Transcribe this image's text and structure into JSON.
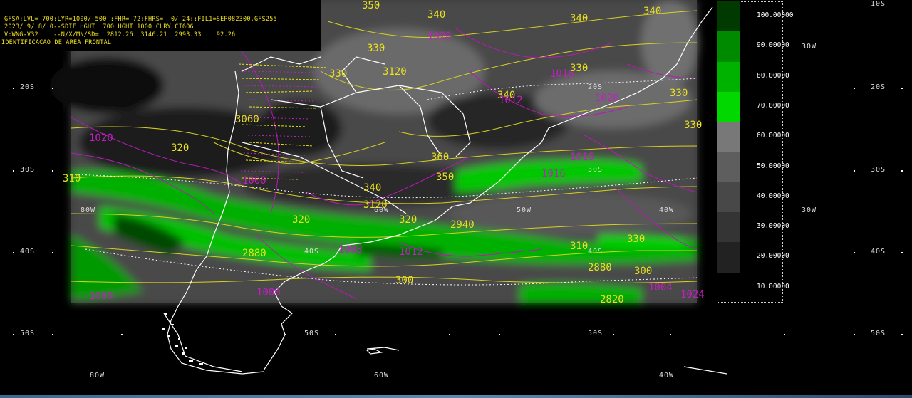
{
  "header": {
    "line1": "GFSA:LVL= 700:LYR=1000/ 500 :FHR= 72:FHRS=  0/ 24::FIL1=SEP082300.GFS255",
    "line2": "2023/ 9/ 8/ 0--SDIF HGHT  700 HGHT 1000 CLRY CI606",
    "line3": "V:WNG-V32    --N/X/MN/SD=  2812.26  3146.21  2993.33    92.26",
    "line4": "IDENTIFICACAO DE AREA FRONTAL"
  },
  "legend": {
    "levels": [
      "100.00000",
      "90.00000",
      "80.00000",
      "70.00000",
      "60.00000",
      "50.00000",
      "40.00000",
      "30.00000",
      "20.00000",
      "10.00000"
    ],
    "colors": [
      "#003a00",
      "#008a00",
      "#00b200",
      "#00d800",
      "#787878",
      "#5e5e5e",
      "#484848",
      "#343434",
      "#222222",
      "#111111"
    ]
  },
  "grid_labels": {
    "lat": [
      "20S",
      "30S",
      "40S",
      "50S"
    ],
    "lon": [
      "80W",
      "60W",
      "40W",
      "30W"
    ]
  },
  "contour_labels_yellow": [
    "350",
    "330",
    "320",
    "310",
    "340",
    "3120",
    "330",
    "3060",
    "360",
    "350",
    "340",
    "330",
    "320",
    "320",
    "340",
    "330",
    "3120",
    "310",
    "300",
    "330",
    "330",
    "340",
    "340",
    "2940",
    "2880",
    "2880",
    "2820",
    "300"
  ],
  "contour_labels_magenta": [
    "1020",
    "1012",
    "1016",
    "1020",
    "1012",
    "1016",
    "1008",
    "1000",
    "1004",
    "1000",
    "1000",
    "1024",
    "1020",
    "1016"
  ],
  "colors": {
    "yellow": "#e8e020",
    "magenta": "#c020c0",
    "coast": "#ffffff"
  }
}
